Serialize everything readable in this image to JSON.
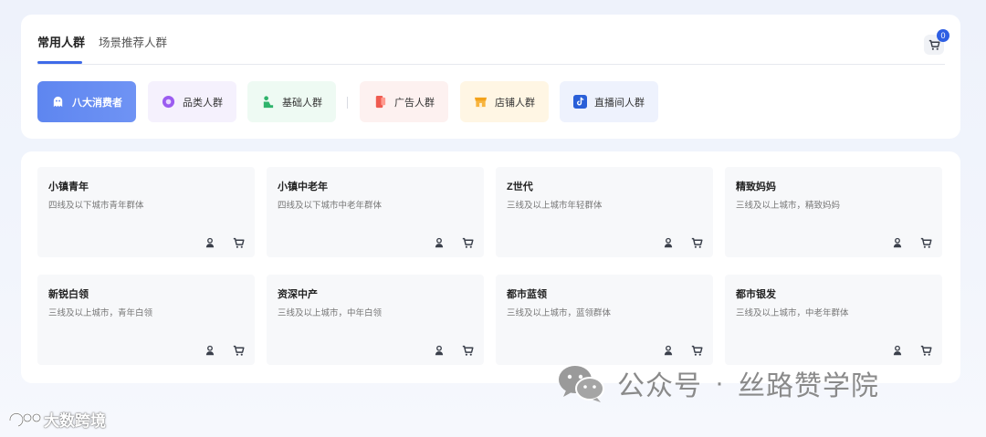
{
  "tabs": [
    {
      "label": "常用人群",
      "active": true
    },
    {
      "label": "场景推荐人群",
      "active": false
    }
  ],
  "cart": {
    "count": "0"
  },
  "categories": [
    {
      "label": "八大消费者",
      "icon": "ghost-icon",
      "active": true
    },
    {
      "label": "品类人群",
      "icon": "disc-icon"
    },
    {
      "label": "基础人群",
      "icon": "person-seat-icon"
    },
    {
      "label": "广告人群",
      "icon": "phone-card-icon"
    },
    {
      "label": "店铺人群",
      "icon": "store-icon"
    },
    {
      "label": "直播间人群",
      "icon": "tiktok-icon"
    }
  ],
  "cards": [
    {
      "title": "小镇青年",
      "desc": "四线及以下城市青年群体"
    },
    {
      "title": "小镇中老年",
      "desc": "四线及以下城市中老年群体"
    },
    {
      "title": "Z世代",
      "desc": "三线及以上城市年轻群体"
    },
    {
      "title": "精致妈妈",
      "desc": "三线及以上城市，精致妈妈"
    },
    {
      "title": "新锐白领",
      "desc": "三线及以上城市，青年白领"
    },
    {
      "title": "资深中产",
      "desc": "三线及以上城市，中年白领"
    },
    {
      "title": "都市蓝领",
      "desc": "三线及以上城市，蓝领群体"
    },
    {
      "title": "都市银发",
      "desc": "三线及以上城市，中老年群体"
    }
  ],
  "watermark": {
    "left": "大数跨境",
    "right_a": "公众号",
    "separator": "·",
    "right_b": "丝路赞学院"
  },
  "colors": {
    "accent": "#3e6ae8",
    "badge": "#2f5fe3"
  }
}
